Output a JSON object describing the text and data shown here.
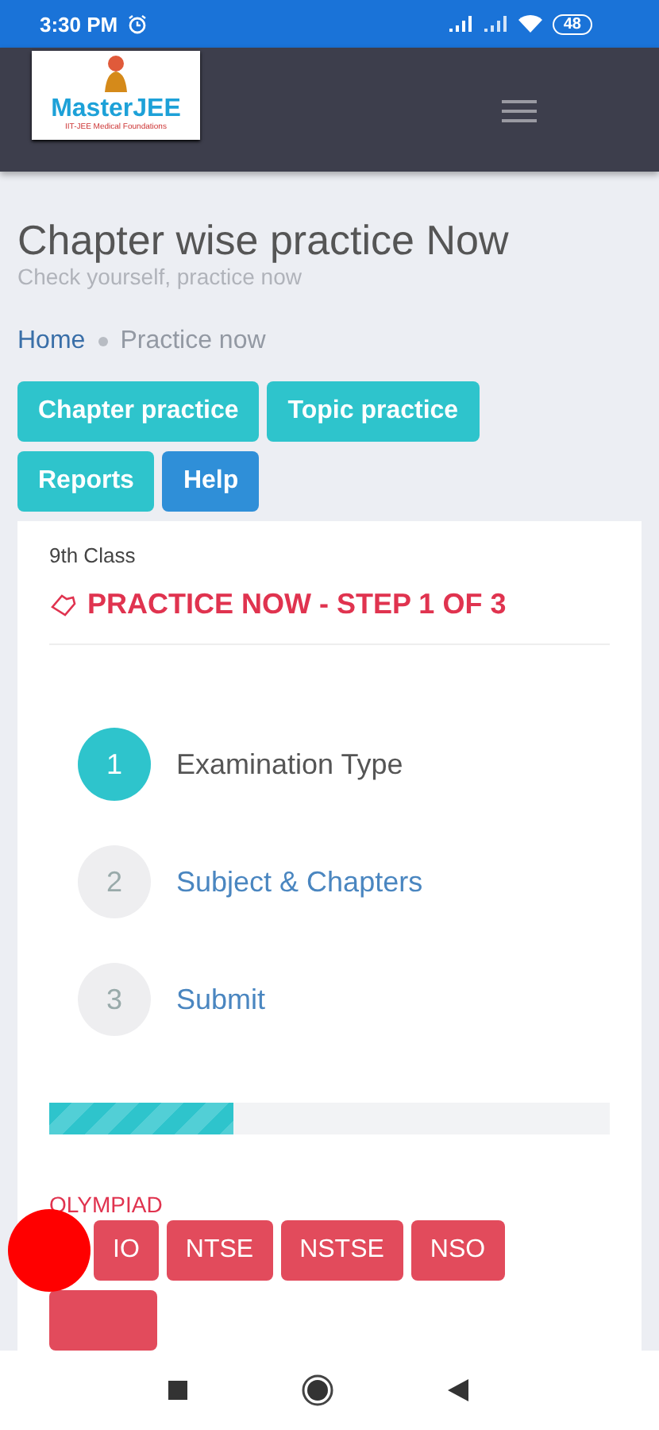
{
  "status_bar": {
    "time": "3:30 PM",
    "battery": "48"
  },
  "header": {
    "logo": {
      "name": "MasterJEE",
      "tagline": "IIT-JEE Medical Foundations"
    }
  },
  "page": {
    "title": "Chapter wise practice Now",
    "subtitle": "Check yourself, practice now"
  },
  "breadcrumb": [
    {
      "label": "Home",
      "selected": false
    },
    {
      "label": "Practice now",
      "selected": true
    }
  ],
  "nav_buttons": [
    {
      "label": "Chapter practice",
      "kind": "teal"
    },
    {
      "label": "Topic practice",
      "kind": "teal"
    },
    {
      "label": "Reports",
      "kind": "teal"
    },
    {
      "label": "Help",
      "kind": "blue"
    }
  ],
  "card": {
    "class_label": "9th Class",
    "heading": "PRACTICE NOW - STEP 1 OF 3",
    "steps": [
      {
        "number": "1",
        "label": "Examination Type",
        "selected": true
      },
      {
        "number": "2",
        "label": "Subject & Chapters",
        "selected": false
      },
      {
        "number": "3",
        "label": "Submit",
        "selected": false
      }
    ],
    "progress": {
      "level": 0.33
    },
    "olympiad": {
      "title": "OLYMPIAD",
      "exams": [
        {
          "label": "IO"
        },
        {
          "label": "NTSE"
        },
        {
          "label": "NSTSE"
        },
        {
          "label": "NSO"
        }
      ]
    }
  }
}
